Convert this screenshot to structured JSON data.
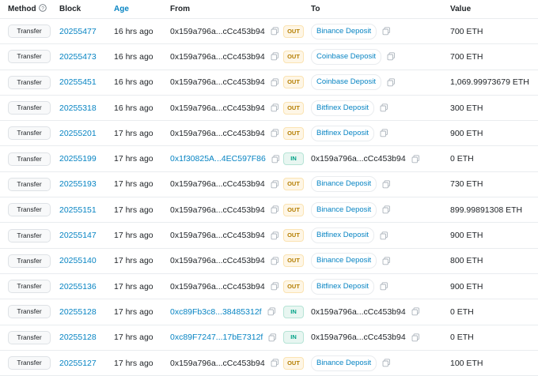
{
  "header": {
    "method": "Method",
    "block": "Block",
    "age": "Age",
    "from": "From",
    "to": "To",
    "value": "Value"
  },
  "colors": {
    "link": "#0784c3",
    "out_bg": "#fef6e6",
    "out_fg": "#b47d00",
    "in_bg": "#e8f6f1",
    "in_fg": "#00a186"
  },
  "rows": [
    {
      "method": "Transfer",
      "block": "20255477",
      "age": "16 hrs ago",
      "from": "0x159a796a...cCc453b94",
      "from_link": false,
      "direction": "OUT",
      "to": "Binance Deposit",
      "to_tag": true,
      "value": "700 ETH"
    },
    {
      "method": "Transfer",
      "block": "20255473",
      "age": "16 hrs ago",
      "from": "0x159a796a...cCc453b94",
      "from_link": false,
      "direction": "OUT",
      "to": "Coinbase Deposit",
      "to_tag": true,
      "value": "700 ETH"
    },
    {
      "method": "Transfer",
      "block": "20255451",
      "age": "16 hrs ago",
      "from": "0x159a796a...cCc453b94",
      "from_link": false,
      "direction": "OUT",
      "to": "Coinbase Deposit",
      "to_tag": true,
      "value": "1,069.99973679 ETH"
    },
    {
      "method": "Transfer",
      "block": "20255318",
      "age": "16 hrs ago",
      "from": "0x159a796a...cCc453b94",
      "from_link": false,
      "direction": "OUT",
      "to": "Bitfinex Deposit",
      "to_tag": true,
      "value": "300 ETH"
    },
    {
      "method": "Transfer",
      "block": "20255201",
      "age": "17 hrs ago",
      "from": "0x159a796a...cCc453b94",
      "from_link": false,
      "direction": "OUT",
      "to": "Bitfinex Deposit",
      "to_tag": true,
      "value": "900 ETH"
    },
    {
      "method": "Transfer",
      "block": "20255199",
      "age": "17 hrs ago",
      "from": "0x1f30825A...4EC597F86",
      "from_link": true,
      "direction": "IN",
      "to": "0x159a796a...cCc453b94",
      "to_tag": false,
      "value": "0 ETH"
    },
    {
      "method": "Transfer",
      "block": "20255193",
      "age": "17 hrs ago",
      "from": "0x159a796a...cCc453b94",
      "from_link": false,
      "direction": "OUT",
      "to": "Binance Deposit",
      "to_tag": true,
      "value": "730 ETH"
    },
    {
      "method": "Transfer",
      "block": "20255151",
      "age": "17 hrs ago",
      "from": "0x159a796a...cCc453b94",
      "from_link": false,
      "direction": "OUT",
      "to": "Binance Deposit",
      "to_tag": true,
      "value": "899.99891308 ETH"
    },
    {
      "method": "Transfer",
      "block": "20255147",
      "age": "17 hrs ago",
      "from": "0x159a796a...cCc453b94",
      "from_link": false,
      "direction": "OUT",
      "to": "Bitfinex Deposit",
      "to_tag": true,
      "value": "900 ETH"
    },
    {
      "method": "Transfer",
      "block": "20255140",
      "age": "17 hrs ago",
      "from": "0x159a796a...cCc453b94",
      "from_link": false,
      "direction": "OUT",
      "to": "Binance Deposit",
      "to_tag": true,
      "value": "800 ETH"
    },
    {
      "method": "Transfer",
      "block": "20255136",
      "age": "17 hrs ago",
      "from": "0x159a796a...cCc453b94",
      "from_link": false,
      "direction": "OUT",
      "to": "Bitfinex Deposit",
      "to_tag": true,
      "value": "900 ETH"
    },
    {
      "method": "Transfer",
      "block": "20255128",
      "age": "17 hrs ago",
      "from": "0xc89Fb3c8...38485312f",
      "from_link": true,
      "direction": "IN",
      "to": "0x159a796a...cCc453b94",
      "to_tag": false,
      "value": "0 ETH"
    },
    {
      "method": "Transfer",
      "block": "20255128",
      "age": "17 hrs ago",
      "from": "0xc89F7247...17bE7312f",
      "from_link": true,
      "direction": "IN",
      "to": "0x159a796a...cCc453b94",
      "to_tag": false,
      "value": "0 ETH"
    },
    {
      "method": "Transfer",
      "block": "20255127",
      "age": "17 hrs ago",
      "from": "0x159a796a...cCc453b94",
      "from_link": false,
      "direction": "OUT",
      "to": "Binance Deposit",
      "to_tag": true,
      "value": "100 ETH"
    }
  ]
}
